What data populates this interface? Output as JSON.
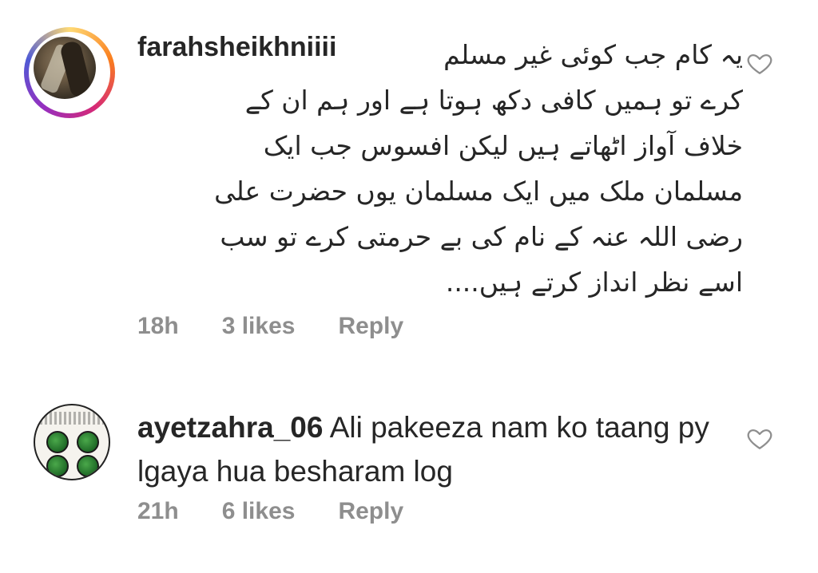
{
  "comments": [
    {
      "username": "farahsheikhniiii",
      "text_lines": [
        "یہ کام جب کوئی غیر مسلم",
        "کرے تو ہمیں کافی دکھ ہوتا ہے اور ہم ان کے",
        "خلاف آواز اٹھاتے ہیں لیکن افسوس جب ایک",
        "مسلمان ملک میں ایک مسلمان یوں حضرت علی",
        "رضی اللہ عنہ کے نام کی بے حرمتی کرے تو سب",
        "اسے نظر انداز کرتے ہیں...."
      ],
      "time": "18h",
      "likes": "3 likes",
      "reply": "Reply",
      "avatar_icon": "profile-photo",
      "heart_icon": "heart-outline-icon"
    },
    {
      "username": "ayetzahra_06",
      "text": "Ali pakeeza nam ko taang py lgaya hua besharam log",
      "time": "21h",
      "likes": "6 likes",
      "reply": "Reply",
      "avatar_icon": "calligraphy-emblems",
      "heart_icon": "heart-outline-icon"
    }
  ],
  "colors": {
    "text": "#262626",
    "meta": "#8e8e8e",
    "story_ring": "#d62976"
  }
}
